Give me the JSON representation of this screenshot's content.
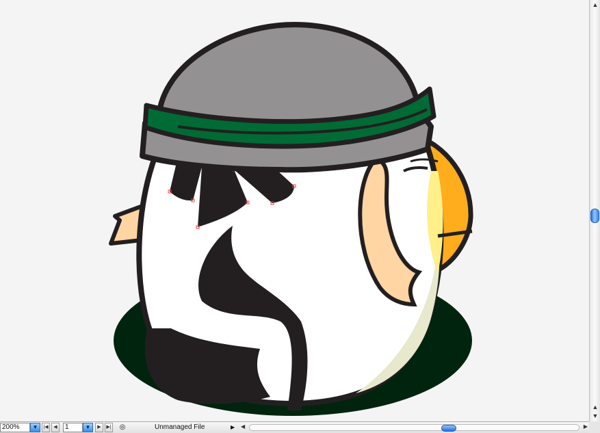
{
  "statusbar": {
    "zoom": "200%",
    "page_number": "1",
    "document_status": "Unmanaged File"
  },
  "icons": {
    "zoom_dropdown": "chevron-down-icon",
    "page_dropdown": "chevron-down-icon",
    "first_page": "first-page-icon",
    "prev_page": "previous-page-icon",
    "next_page": "next-page-icon",
    "last_page": "last-page-icon",
    "version_cue": "version-cue-icon",
    "status_menu": "triangle-right-icon"
  },
  "colors": {
    "outline": "#231f20",
    "hat_gray": "#939192",
    "headband_green": "#006b35",
    "ground_green": "#00240e",
    "skin": "#ffd5a3",
    "beak_orange": "#ffad1d",
    "highlight_yellow": "#fff08a",
    "shade": "#e8e8cc",
    "selection_red": "#ff3b3b",
    "scroll_blue": "#3d86e8"
  }
}
